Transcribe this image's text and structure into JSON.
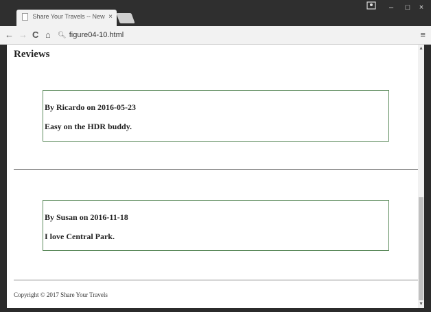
{
  "browser": {
    "tab_title": "Share Your Travels -- New",
    "tab_close": "×",
    "url": "figure04-10.html",
    "controls": {
      "minimize": "–",
      "maximize": "□",
      "close": "×"
    },
    "nav": {
      "back": "←",
      "forward": "→",
      "reload": "C",
      "home": "⌂",
      "menu": "≡"
    }
  },
  "page": {
    "heading": "Reviews",
    "reviews": [
      {
        "by": "By Ricardo on 2016-05-23",
        "text": "Easy on the HDR buddy."
      },
      {
        "by": "By Susan on 2016-11-18",
        "text": "I love Central Park."
      }
    ],
    "footer": "Copyright © 2017 Share Your Travels"
  },
  "colors": {
    "review_border": "#5b8a5b",
    "chrome_dark": "#2f2f2f",
    "toolbar_bg": "#f2f2f2"
  }
}
